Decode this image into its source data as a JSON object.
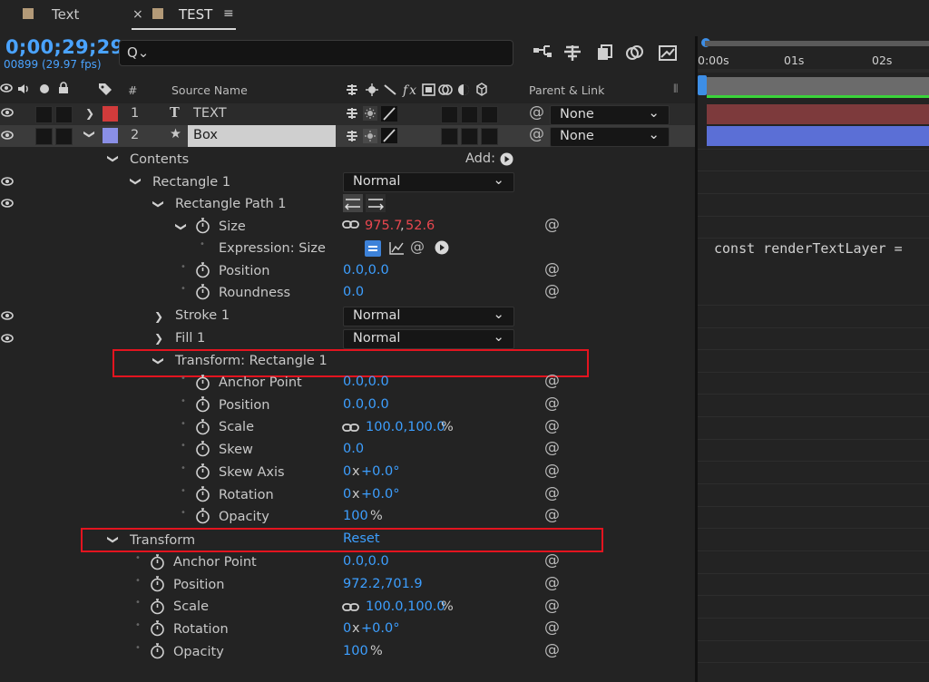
{
  "tabs": [
    {
      "label": "Text"
    },
    {
      "label": "TEST",
      "close": "×",
      "menu": "≡"
    }
  ],
  "timecode": "0;00;29;29",
  "fps": "00899 (29.97 fps)",
  "search": {
    "icon": "Q⌄",
    "placeholder": ""
  },
  "header": {
    "hash": "#",
    "source_name": "Source Name",
    "parent_link": "Parent & Link",
    "switch_fx": "fx"
  },
  "ruler": {
    "ticks": [
      "0:00s",
      "01s",
      "02s"
    ]
  },
  "expression_text": "const renderTextLayer =",
  "layers": [
    {
      "num": "1",
      "type_icon": "T",
      "name": "TEXT",
      "label_color": "#d13b3b",
      "parent": "None"
    },
    {
      "num": "2",
      "type_icon": "★",
      "name": "Box",
      "label_color": "#8a8fe6",
      "parent": "None"
    }
  ],
  "contents": {
    "label": "Contents",
    "add_label": "Add:"
  },
  "rect1": {
    "label": "Rectangle 1",
    "mode": "Normal"
  },
  "rect_path": {
    "label": "Rectangle Path 1"
  },
  "size": {
    "label": "Size",
    "x": "975.7",
    "y": "52.6"
  },
  "expression_size": {
    "label": "Expression: Size"
  },
  "path_position": {
    "label": "Position",
    "value": "0.0,0.0"
  },
  "roundness": {
    "label": "Roundness",
    "value": "0.0"
  },
  "stroke": {
    "label": "Stroke 1",
    "mode": "Normal"
  },
  "fill": {
    "label": "Fill 1",
    "mode": "Normal"
  },
  "transform_rect": {
    "label": "Transform: Rectangle 1",
    "anchor": {
      "label": "Anchor Point",
      "value": "0.0,0.0"
    },
    "position": {
      "label": "Position",
      "value": "0.0,0.0"
    },
    "scale": {
      "label": "Scale",
      "value": "100.0,100.0",
      "unit": "%"
    },
    "skew": {
      "label": "Skew",
      "value": "0.0"
    },
    "skew_axis": {
      "label": "Skew Axis",
      "rev": "0",
      "x": "x",
      "deg": "+0.0°"
    },
    "rotation": {
      "label": "Rotation",
      "rev": "0",
      "x": "x",
      "deg": "+0.0°"
    },
    "opacity": {
      "label": "Opacity",
      "value": "100",
      "unit": "%"
    }
  },
  "transform": {
    "label": "Transform",
    "reset": "Reset",
    "anchor": {
      "label": "Anchor Point",
      "value": "0.0,0.0"
    },
    "position": {
      "label": "Position",
      "value": "972.2,701.9"
    },
    "scale": {
      "label": "Scale",
      "value": "100.0,100.0",
      "unit": "%"
    },
    "rotation": {
      "label": "Rotation",
      "rev": "0",
      "x": "x",
      "deg": "+0.0°"
    },
    "opacity": {
      "label": "Opacity",
      "value": "100",
      "unit": "%"
    }
  },
  "icons": [
    "search-icon",
    "stopwatch-icon",
    "pick-whip-icon",
    "link-icon",
    "eye-icon",
    "lock-icon",
    "label-tag-icon"
  ],
  "colors": {
    "accent": "#3d9fff",
    "value_red": "#e8474f",
    "highlight_box": "#e3141f",
    "work_area": "#3ad43a"
  }
}
